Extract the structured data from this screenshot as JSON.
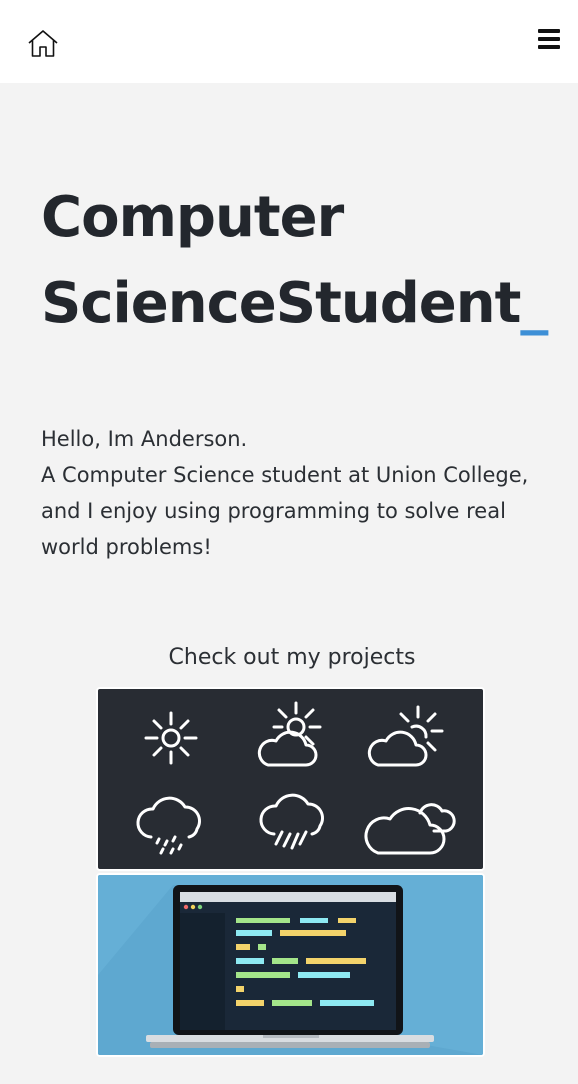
{
  "nav": {
    "home_icon": "home-icon",
    "menu_icon": "hamburger-menu-icon"
  },
  "hero": {
    "title_line1": "Computer",
    "title_line2": "ScienceStudent",
    "cursor": "_",
    "cursor_color": "#3d8fd6"
  },
  "intro": {
    "line1": "Hello, Im Anderson.",
    "line2": "A Computer Science student at Union College, and I enjoy using programming to solve real world problems!"
  },
  "projects": {
    "heading": "Check out my projects",
    "cards": [
      {
        "name": "weather-project-card",
        "icons": [
          "sun-icon",
          "sun-cloud-icon",
          "partly-cloudy-icon",
          "rain-light-icon",
          "rain-heavy-icon",
          "cloudy-icon"
        ]
      },
      {
        "name": "code-project-card",
        "icons": [
          "laptop-code-icon"
        ]
      }
    ]
  }
}
